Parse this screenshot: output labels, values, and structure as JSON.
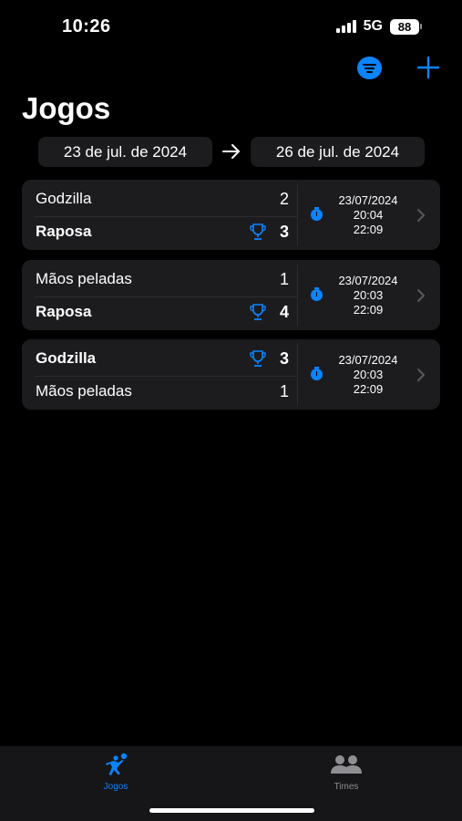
{
  "status_bar": {
    "time": "10:26",
    "network": "5G",
    "battery": "88"
  },
  "nav": {
    "title": "Jogos",
    "filter_icon": "filter-circle-icon",
    "add_icon": "plus-icon"
  },
  "date_range": {
    "start": "23 de jul. de 2024",
    "end": "26 de jul. de 2024"
  },
  "games": [
    {
      "team1": {
        "name": "Godzilla",
        "score": "2",
        "winner": false
      },
      "team2": {
        "name": "Raposa",
        "score": "3",
        "winner": true
      },
      "date": "23/07/2024",
      "start_time": "20:04",
      "end_time": "22:09"
    },
    {
      "team1": {
        "name": "Mãos peladas",
        "score": "1",
        "winner": false
      },
      "team2": {
        "name": "Raposa",
        "score": "4",
        "winner": true
      },
      "date": "23/07/2024",
      "start_time": "20:03",
      "end_time": "22:09"
    },
    {
      "team1": {
        "name": "Godzilla",
        "score": "3",
        "winner": true
      },
      "team2": {
        "name": "Mãos peladas",
        "score": "1",
        "winner": false
      },
      "date": "23/07/2024",
      "start_time": "20:03",
      "end_time": "22:09"
    }
  ],
  "tab_bar": {
    "tabs": [
      {
        "label": "Jogos",
        "icon": "volleyball-player-icon",
        "selected": true
      },
      {
        "label": "Times",
        "icon": "people-icon",
        "selected": false
      }
    ]
  },
  "colors": {
    "accent": "#0a84ff",
    "card_background": "#1c1c1e",
    "background": "#000000"
  }
}
